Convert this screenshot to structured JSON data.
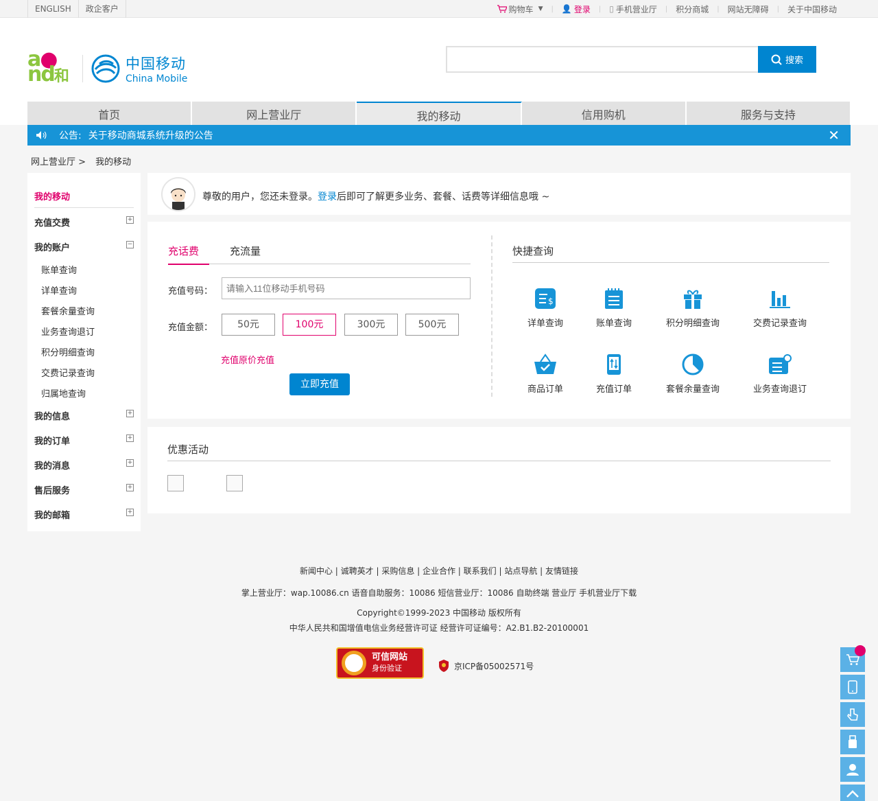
{
  "topbar": {
    "left": [
      "ENGLISH",
      "政企客户"
    ],
    "cart": "购物车",
    "login": "登录",
    "mobile_hall": "手机营业厅",
    "points_mall": "积分商城",
    "accessible": "网站无障碍",
    "about": "关于中国移动"
  },
  "brand": {
    "and_logo": "and",
    "he": "和",
    "cm_cn": "中国移动",
    "cm_en": "China Mobile"
  },
  "search": {
    "value": "",
    "button": "搜索"
  },
  "nav": [
    "首页",
    "网上营业厅",
    "我的移动",
    "信用购机",
    "服务与支持"
  ],
  "nav_active": "我的移动",
  "notice": {
    "label": "公告:",
    "text": "关于移动商城系统升级的公告"
  },
  "breadcrumb": {
    "level1": "网上营业厅 >",
    "level2": "我的移动"
  },
  "sidebar": {
    "title": "我的移动",
    "groups": [
      {
        "label": "充值交费",
        "toggle": "+"
      },
      {
        "label": "我的账户",
        "toggle": "−"
      },
      {
        "label": "我的信息",
        "toggle": "+"
      },
      {
        "label": "我的订单",
        "toggle": "+"
      },
      {
        "label": "我的消息",
        "toggle": "+"
      },
      {
        "label": "售后服务",
        "toggle": "+"
      },
      {
        "label": "我的邮箱",
        "toggle": "+"
      }
    ],
    "account_items": [
      "账单查询",
      "详单查询",
      "套餐余量查询",
      "业务查询退订",
      "积分明细查询",
      "交费记录查询",
      "归属地查询"
    ]
  },
  "login_prompt": {
    "pre": "尊敬的用户，您还未登录。",
    "link": "登录",
    "post": "后即可了解更多业务、套餐、话费等详细信息哦 ~"
  },
  "recharge": {
    "tabs": [
      "充话费",
      "充流量"
    ],
    "phone_label": "充值号码：",
    "phone_placeholder": "请输入11位移动手机号码",
    "amount_label": "充值金额：",
    "amounts": [
      "50元",
      "100元",
      "300元",
      "500元"
    ],
    "selected_amount": "100元",
    "original_price": "充值原价充值",
    "submit": "立即充值"
  },
  "quick": {
    "title": "快捷查询",
    "items": [
      {
        "label": "详单查询",
        "icon": "bill-detail-icon"
      },
      {
        "label": "账单查询",
        "icon": "bill-icon"
      },
      {
        "label": "积分明细查询",
        "icon": "gift-icon"
      },
      {
        "label": "交费记录查询",
        "icon": "bar-chart-icon"
      },
      {
        "label": "商品订单",
        "icon": "basket-icon"
      },
      {
        "label": "充值订单",
        "icon": "phone-recharge-icon"
      },
      {
        "label": "套餐余量查询",
        "icon": "pie-icon"
      },
      {
        "label": "业务查询退订",
        "icon": "service-icon"
      }
    ]
  },
  "promo": {
    "title": "优惠活动"
  },
  "footer": {
    "links": "新闻中心 | 诚聘英才 | 采购信息 | 企业合作 | 联系我们 | 站点导航 | 友情链接",
    "services": "掌上营业厅：wap.10086.cn 语音自助服务：10086 短信营业厅：10086 自助终端 营业厅 手机营业厅下载",
    "copyright": "Copyright©1999-2023  中国移动  版权所有",
    "license": "中华人民共和国增值电信业务经营许可证  经营许可证编号：A2.B1.B2-20100001",
    "trust_title": "可信网站",
    "trust_sub": "身份验证",
    "icp": "京ICP备05002571号"
  },
  "colors": {
    "brand_blue": "#0085d0",
    "accent_pink": "#e0006c",
    "notice_blue": "#1794d7"
  }
}
